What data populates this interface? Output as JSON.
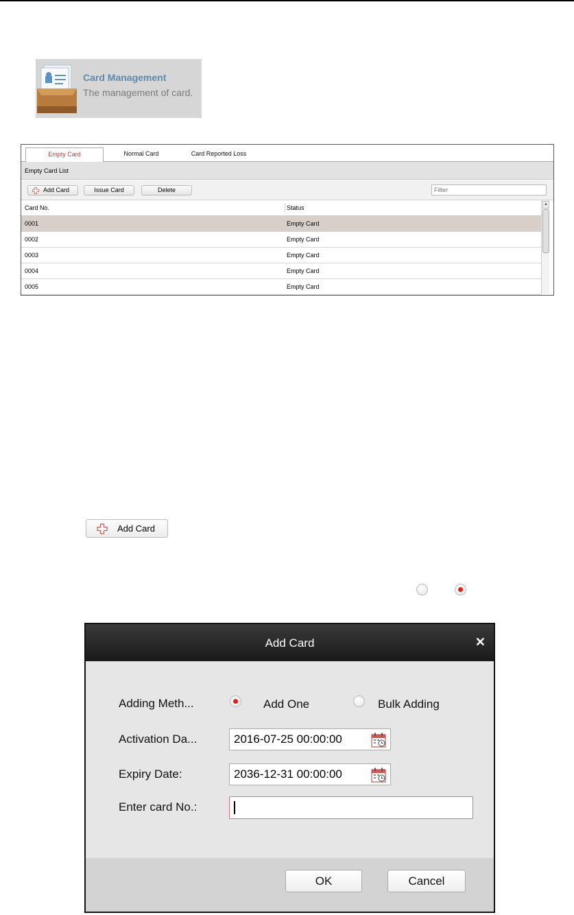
{
  "banner": {
    "title": "Card Management",
    "description": "The management of card."
  },
  "panel": {
    "tabs": [
      {
        "label": "Empty Card",
        "active": true
      },
      {
        "label": "Normal Card",
        "active": false
      },
      {
        "label": "Card Reported Loss",
        "active": false
      }
    ],
    "list_title": "Empty Card List",
    "toolbar": {
      "add_label": "Add Card",
      "issue_label": "Issue Card",
      "delete_label": "Delete",
      "filter_placeholder": "Filter"
    },
    "columns": [
      "Card No.",
      "Status"
    ],
    "rows": [
      {
        "card_no": "0001",
        "status": "Empty Card",
        "selected": true
      },
      {
        "card_no": "0002",
        "status": "Empty Card",
        "selected": false
      },
      {
        "card_no": "0003",
        "status": "Empty Card",
        "selected": false
      },
      {
        "card_no": "0004",
        "status": "Empty Card",
        "selected": false
      },
      {
        "card_no": "0005",
        "status": "Empty Card",
        "selected": false
      }
    ]
  },
  "inline_button": {
    "label": "Add Card"
  },
  "dialog": {
    "title": "Add Card",
    "close_icon": "close-icon",
    "adding_method_label": "Adding Meth...",
    "option_one": "Add One",
    "option_bulk": "Bulk Adding",
    "activation_label": "Activation Da...",
    "activation_value": "2016-07-25 00:00:00",
    "expiry_label": "Expiry Date:",
    "expiry_value": "2036-12-31 00:00:00",
    "card_no_label": "Enter card No.:",
    "card_no_value": "",
    "ok_label": "OK",
    "cancel_label": "Cancel"
  },
  "colors": {
    "accent_red": "#e0211b",
    "active_tab_text": "#c0392b",
    "banner_title": "#5a8ab0",
    "selected_row": "#d8d0c8"
  }
}
